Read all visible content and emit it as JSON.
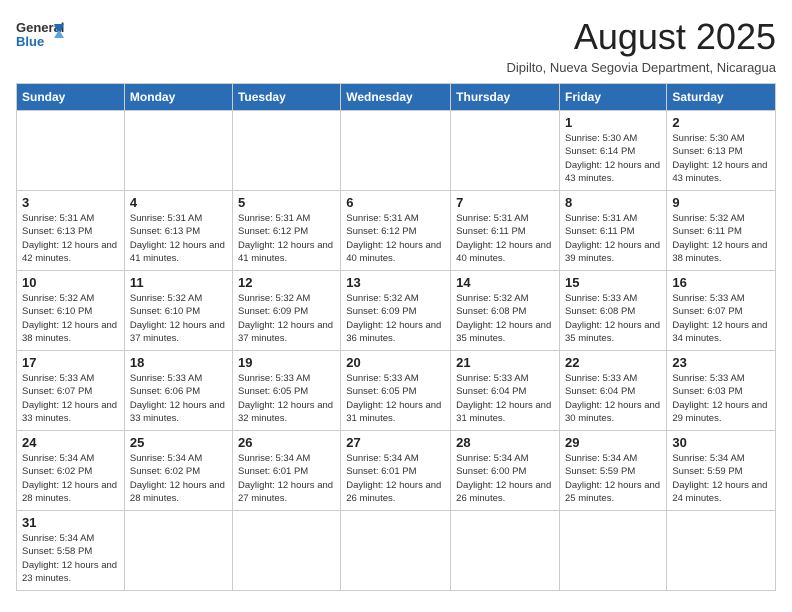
{
  "header": {
    "logo_general": "General",
    "logo_blue": "Blue",
    "main_title": "August 2025",
    "subtitle": "Dipilto, Nueva Segovia Department, Nicaragua"
  },
  "weekdays": [
    "Sunday",
    "Monday",
    "Tuesday",
    "Wednesday",
    "Thursday",
    "Friday",
    "Saturday"
  ],
  "weeks": [
    [
      {
        "day": "",
        "info": ""
      },
      {
        "day": "",
        "info": ""
      },
      {
        "day": "",
        "info": ""
      },
      {
        "day": "",
        "info": ""
      },
      {
        "day": "",
        "info": ""
      },
      {
        "day": "1",
        "info": "Sunrise: 5:30 AM\nSunset: 6:14 PM\nDaylight: 12 hours and 43 minutes."
      },
      {
        "day": "2",
        "info": "Sunrise: 5:30 AM\nSunset: 6:13 PM\nDaylight: 12 hours and 43 minutes."
      }
    ],
    [
      {
        "day": "3",
        "info": "Sunrise: 5:31 AM\nSunset: 6:13 PM\nDaylight: 12 hours and 42 minutes."
      },
      {
        "day": "4",
        "info": "Sunrise: 5:31 AM\nSunset: 6:13 PM\nDaylight: 12 hours and 41 minutes."
      },
      {
        "day": "5",
        "info": "Sunrise: 5:31 AM\nSunset: 6:12 PM\nDaylight: 12 hours and 41 minutes."
      },
      {
        "day": "6",
        "info": "Sunrise: 5:31 AM\nSunset: 6:12 PM\nDaylight: 12 hours and 40 minutes."
      },
      {
        "day": "7",
        "info": "Sunrise: 5:31 AM\nSunset: 6:11 PM\nDaylight: 12 hours and 40 minutes."
      },
      {
        "day": "8",
        "info": "Sunrise: 5:31 AM\nSunset: 6:11 PM\nDaylight: 12 hours and 39 minutes."
      },
      {
        "day": "9",
        "info": "Sunrise: 5:32 AM\nSunset: 6:11 PM\nDaylight: 12 hours and 38 minutes."
      }
    ],
    [
      {
        "day": "10",
        "info": "Sunrise: 5:32 AM\nSunset: 6:10 PM\nDaylight: 12 hours and 38 minutes."
      },
      {
        "day": "11",
        "info": "Sunrise: 5:32 AM\nSunset: 6:10 PM\nDaylight: 12 hours and 37 minutes."
      },
      {
        "day": "12",
        "info": "Sunrise: 5:32 AM\nSunset: 6:09 PM\nDaylight: 12 hours and 37 minutes."
      },
      {
        "day": "13",
        "info": "Sunrise: 5:32 AM\nSunset: 6:09 PM\nDaylight: 12 hours and 36 minutes."
      },
      {
        "day": "14",
        "info": "Sunrise: 5:32 AM\nSunset: 6:08 PM\nDaylight: 12 hours and 35 minutes."
      },
      {
        "day": "15",
        "info": "Sunrise: 5:33 AM\nSunset: 6:08 PM\nDaylight: 12 hours and 35 minutes."
      },
      {
        "day": "16",
        "info": "Sunrise: 5:33 AM\nSunset: 6:07 PM\nDaylight: 12 hours and 34 minutes."
      }
    ],
    [
      {
        "day": "17",
        "info": "Sunrise: 5:33 AM\nSunset: 6:07 PM\nDaylight: 12 hours and 33 minutes."
      },
      {
        "day": "18",
        "info": "Sunrise: 5:33 AM\nSunset: 6:06 PM\nDaylight: 12 hours and 33 minutes."
      },
      {
        "day": "19",
        "info": "Sunrise: 5:33 AM\nSunset: 6:05 PM\nDaylight: 12 hours and 32 minutes."
      },
      {
        "day": "20",
        "info": "Sunrise: 5:33 AM\nSunset: 6:05 PM\nDaylight: 12 hours and 31 minutes."
      },
      {
        "day": "21",
        "info": "Sunrise: 5:33 AM\nSunset: 6:04 PM\nDaylight: 12 hours and 31 minutes."
      },
      {
        "day": "22",
        "info": "Sunrise: 5:33 AM\nSunset: 6:04 PM\nDaylight: 12 hours and 30 minutes."
      },
      {
        "day": "23",
        "info": "Sunrise: 5:33 AM\nSunset: 6:03 PM\nDaylight: 12 hours and 29 minutes."
      }
    ],
    [
      {
        "day": "24",
        "info": "Sunrise: 5:34 AM\nSunset: 6:02 PM\nDaylight: 12 hours and 28 minutes."
      },
      {
        "day": "25",
        "info": "Sunrise: 5:34 AM\nSunset: 6:02 PM\nDaylight: 12 hours and 28 minutes."
      },
      {
        "day": "26",
        "info": "Sunrise: 5:34 AM\nSunset: 6:01 PM\nDaylight: 12 hours and 27 minutes."
      },
      {
        "day": "27",
        "info": "Sunrise: 5:34 AM\nSunset: 6:01 PM\nDaylight: 12 hours and 26 minutes."
      },
      {
        "day": "28",
        "info": "Sunrise: 5:34 AM\nSunset: 6:00 PM\nDaylight: 12 hours and 26 minutes."
      },
      {
        "day": "29",
        "info": "Sunrise: 5:34 AM\nSunset: 5:59 PM\nDaylight: 12 hours and 25 minutes."
      },
      {
        "day": "30",
        "info": "Sunrise: 5:34 AM\nSunset: 5:59 PM\nDaylight: 12 hours and 24 minutes."
      }
    ],
    [
      {
        "day": "31",
        "info": "Sunrise: 5:34 AM\nSunset: 5:58 PM\nDaylight: 12 hours and 23 minutes."
      },
      {
        "day": "",
        "info": ""
      },
      {
        "day": "",
        "info": ""
      },
      {
        "day": "",
        "info": ""
      },
      {
        "day": "",
        "info": ""
      },
      {
        "day": "",
        "info": ""
      },
      {
        "day": "",
        "info": ""
      }
    ]
  ]
}
